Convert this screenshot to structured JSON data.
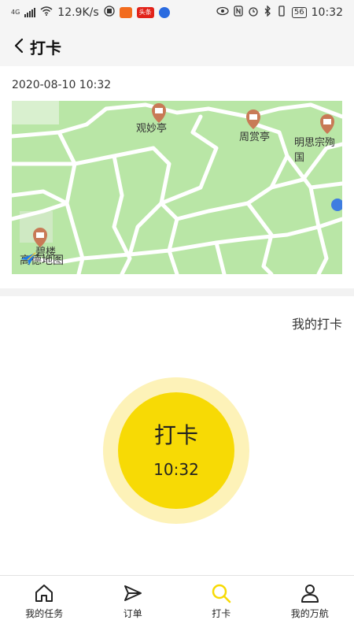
{
  "status_bar": {
    "network": "4G",
    "speed": "12.9K/s",
    "badge_text": "头条",
    "battery": "56",
    "time": "10:32"
  },
  "header": {
    "title": "打卡"
  },
  "checkin": {
    "datetime": "2020-08-10 10:32",
    "my_checkin_link": "我的打卡",
    "button_label": "打卡",
    "button_time": "10:32"
  },
  "map": {
    "pois": [
      "观妙亭",
      "周赏亭",
      "明思宗殉国",
      "碧楼"
    ],
    "logo": "高德地图"
  },
  "colors": {
    "accent": "#f7da05",
    "accent_light": "#fdf2b8",
    "map_green": "#b9e6a6",
    "poi_marker": "#c87a56"
  },
  "bottom_nav": {
    "items": [
      {
        "label": "我的任务",
        "icon": "home-icon"
      },
      {
        "label": "订单",
        "icon": "send-icon"
      },
      {
        "label": "打卡",
        "icon": "search-icon"
      },
      {
        "label": "我的万航",
        "icon": "user-icon"
      }
    ],
    "active_index": 2
  }
}
